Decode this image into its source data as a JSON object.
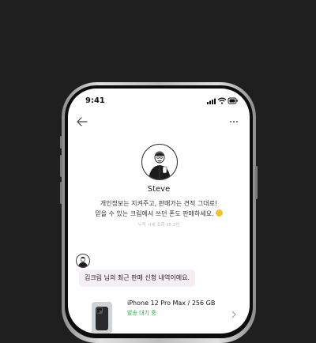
{
  "status_bar": {
    "time": "9:41"
  },
  "nav": {
    "back_icon": "arrow-left-icon",
    "more_icon": "ellipsis-icon"
  },
  "profile": {
    "name": "Steve",
    "description_line1": "개인정보는 지켜주고, 판매가는 견적 그대로!",
    "description_line2": "믿을 수 있는 크림에서 쓰던 폰도 판매하세요.",
    "emoji_icon": "smiling-face-icon",
    "stats": "누적 시세 조회 15.2만"
  },
  "message": {
    "text": "김크림 님의 최근 판매 신청 내역이에요."
  },
  "order": {
    "title": "iPhone 12 Pro Max / 256 GB",
    "status": "발송 대기 중",
    "status_color": "#2aa84a"
  },
  "colors": {
    "background": "#1f1f1f",
    "bubble": "#f5eef5"
  }
}
